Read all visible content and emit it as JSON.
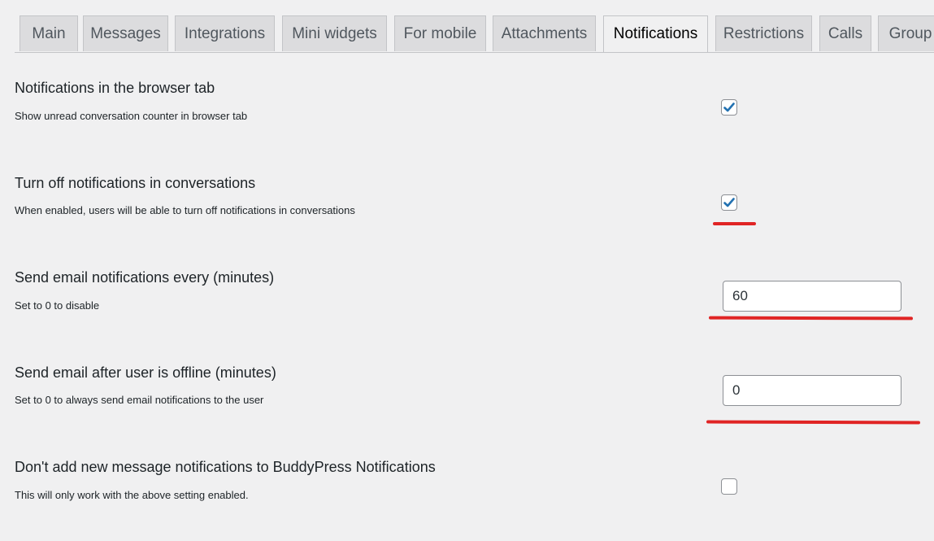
{
  "tabs": [
    {
      "label": "Main"
    },
    {
      "label": "Messages"
    },
    {
      "label": "Integrations"
    },
    {
      "label": "Mini widgets"
    },
    {
      "label": "For mobile"
    },
    {
      "label": "Attachments"
    },
    {
      "label": "Notifications",
      "active": true
    },
    {
      "label": "Restrictions"
    },
    {
      "label": "Calls"
    },
    {
      "label": "Group"
    }
  ],
  "settings": [
    {
      "title": "Notifications in the browser tab",
      "description": "Show unread conversation counter in browser tab",
      "control": "checkbox",
      "checked": true
    },
    {
      "title": "Turn off notifications in conversations",
      "description": "When enabled, users will be able to turn off notifications in conversations",
      "control": "checkbox",
      "checked": true
    },
    {
      "title": "Send email notifications every (minutes)",
      "description": "Set to 0 to disable",
      "control": "number",
      "value": "60"
    },
    {
      "title": "Send email after user is offline (minutes)",
      "description": "Set to 0 to always send email notifications to the user",
      "control": "number",
      "value": "0"
    },
    {
      "title": "Don't add new message notifications to BuddyPress Notifications",
      "description": "This will only work with the above setting enabled.",
      "control": "checkbox",
      "checked": false
    }
  ],
  "colors": {
    "checkmark": "#2271b1",
    "annotation": "#e02424",
    "background": "#f0f0f1"
  }
}
